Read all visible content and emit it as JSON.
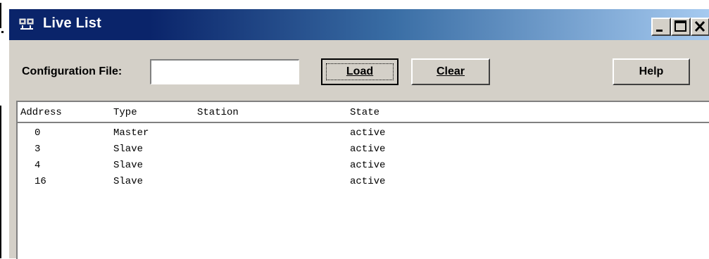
{
  "window": {
    "title": "Live List",
    "icon": "network-icon",
    "controls": [
      "minimize",
      "maximize",
      "close"
    ]
  },
  "toolbar": {
    "config_label": "Configuration File:",
    "config_value": "",
    "load_label": "Load",
    "clear_label": "Clear",
    "help_label": "Help"
  },
  "list": {
    "columns": [
      "Address",
      "Type",
      "Station",
      "State"
    ],
    "rows": [
      {
        "address": "0",
        "type": "Master",
        "station": "",
        "state": "active"
      },
      {
        "address": "3",
        "type": "Slave",
        "station": "",
        "state": "active"
      },
      {
        "address": "4",
        "type": "Slave",
        "station": "",
        "state": "active"
      },
      {
        "address": "16",
        "type": "Slave",
        "station": "",
        "state": "active"
      }
    ]
  },
  "colors": {
    "title_start": "#0a246a",
    "title_end": "#a6caf0",
    "face": "#d4d0c8"
  }
}
